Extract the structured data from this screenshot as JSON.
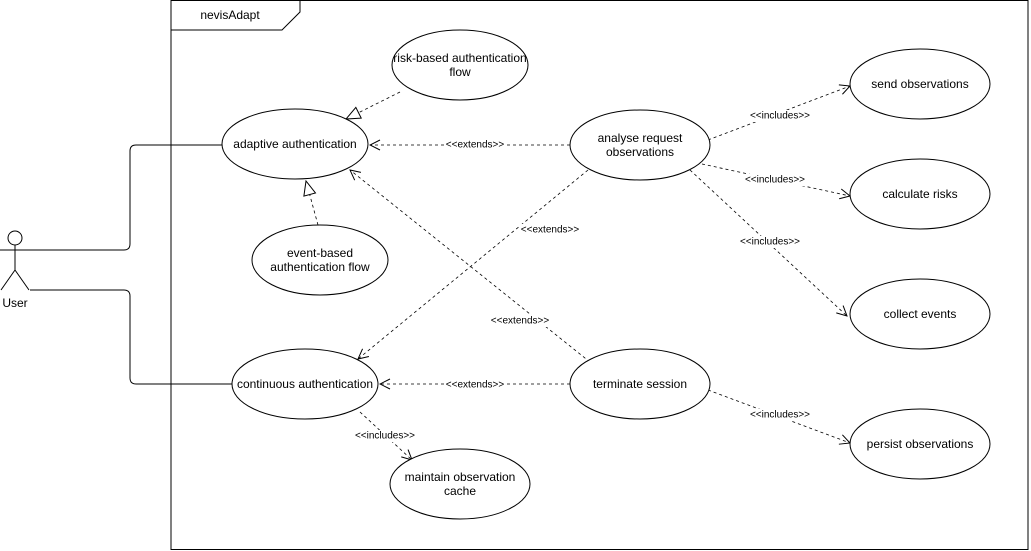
{
  "system": {
    "title": "nevisAdapt"
  },
  "actor": {
    "label": "User"
  },
  "use_cases": {
    "adaptive": [
      "adaptive authentication"
    ],
    "risk_based": [
      "risk-based authentication",
      "flow"
    ],
    "event_based": [
      "event-based",
      "authentication flow"
    ],
    "analyse": [
      "analyse request",
      "observations"
    ],
    "send": [
      "send observations"
    ],
    "calc": [
      "calculate risks"
    ],
    "collect": [
      "collect events"
    ],
    "continuous": [
      "continuous authentication"
    ],
    "terminate": [
      "terminate session"
    ],
    "persist": [
      "persist observations"
    ],
    "maintain": [
      "maintain observation",
      "cache"
    ]
  },
  "relations": {
    "analyse_adaptive": "<<extends>>",
    "analyse_continuous": "<<extends>>",
    "terminate_adaptive": "<<extends>>",
    "terminate_continuous": "<<extends>>",
    "analyse_send": "<<includes>>",
    "analyse_calc": "<<includes>>",
    "analyse_collect": "<<includes>>",
    "terminate_persist": "<<includes>>",
    "continuous_maintain": "<<includes>>"
  }
}
